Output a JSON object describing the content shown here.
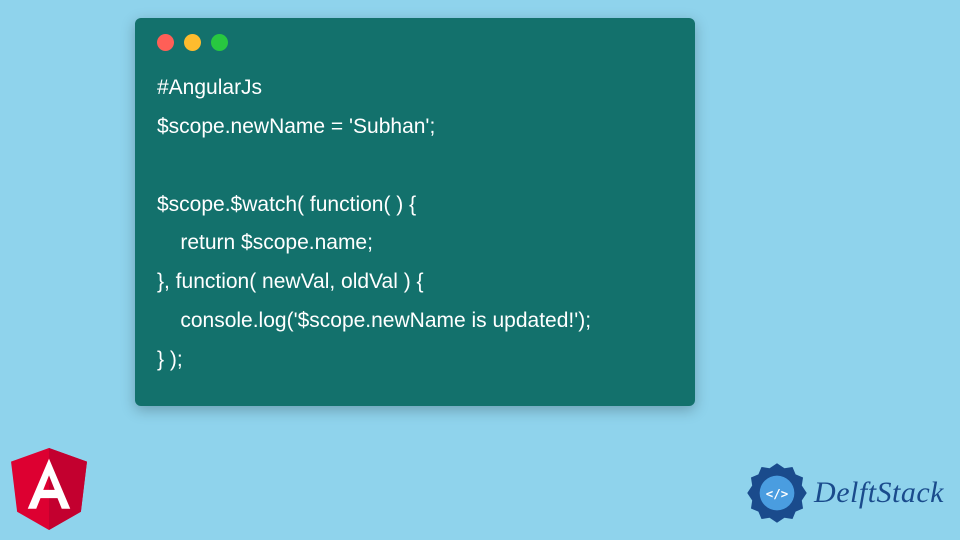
{
  "code": {
    "line1": "#AngularJs",
    "line2": "$scope.newName = 'Subhan';",
    "line3": "",
    "line4": "$scope.$watch( function( ) {",
    "line5": "    return $scope.name;",
    "line6": "}, function( newVal, oldVal ) {",
    "line7": "    console.log('$scope.newName is updated!');",
    "line8": "} );"
  },
  "brand": {
    "name": "DelftStack"
  },
  "colors": {
    "background": "#8fd3ec",
    "window": "#13716c",
    "text": "#ffffff",
    "angular": "#dd0031",
    "delft": "#1a4b8c"
  }
}
